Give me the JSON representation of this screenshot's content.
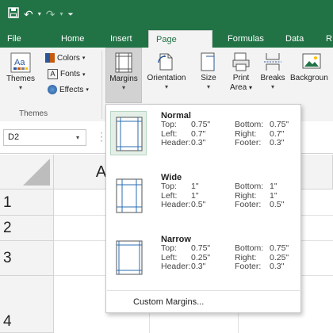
{
  "quick_access": {
    "save_icon": "save-icon",
    "undo_icon": "undo-icon",
    "redo_icon": "redo-icon",
    "customize_icon": "customize-qat-icon"
  },
  "tabs": [
    {
      "label": "File"
    },
    {
      "label": "Home"
    },
    {
      "label": "Insert"
    },
    {
      "label": "Page Layout"
    },
    {
      "label": "Formulas"
    },
    {
      "label": "Data"
    },
    {
      "label": "R"
    }
  ],
  "active_tab": "Page Layout",
  "ribbon": {
    "themes": {
      "label": "Themes",
      "colors": "Colors",
      "fonts": "Fonts",
      "effects": "Effects",
      "group_label": "Themes"
    },
    "margins": {
      "label": "Margins"
    },
    "orientation": {
      "label": "Orientation"
    },
    "size": {
      "label": "Size"
    },
    "print_area": {
      "label1": "Print",
      "label2": "Area"
    },
    "breaks": {
      "label": "Breaks"
    },
    "background": {
      "label": "Backgroun"
    }
  },
  "name_box": {
    "value": "D2"
  },
  "grid": {
    "column_header": "A",
    "rows": [
      "1",
      "2",
      "3",
      "4"
    ]
  },
  "margins_menu": {
    "options": [
      {
        "name": "Normal",
        "selected": true,
        "top": "0.75\"",
        "bottom": "0.75\"",
        "left": "0.7\"",
        "right": "0.7\"",
        "header": "0.3\"",
        "footer": "0.3\""
      },
      {
        "name": "Wide",
        "selected": false,
        "top": "1\"",
        "bottom": "1\"",
        "left": "1\"",
        "right": "1\"",
        "header": "0.5\"",
        "footer": "0.5\""
      },
      {
        "name": "Narrow",
        "selected": false,
        "top": "0.75\"",
        "bottom": "0.75\"",
        "left": "0.25\"",
        "right": "0.25\"",
        "header": "0.3\"",
        "footer": "0.3\""
      }
    ],
    "labels": {
      "top": "Top:",
      "bottom": "Bottom:",
      "left": "Left:",
      "right": "Right:",
      "header": "Header:",
      "footer": "Footer:"
    },
    "custom_label": "Custom Margins..."
  },
  "colors": {
    "accent": "#217346",
    "ribbon_bg": "#f3f3f3",
    "selected_option": "#e3efe7"
  }
}
